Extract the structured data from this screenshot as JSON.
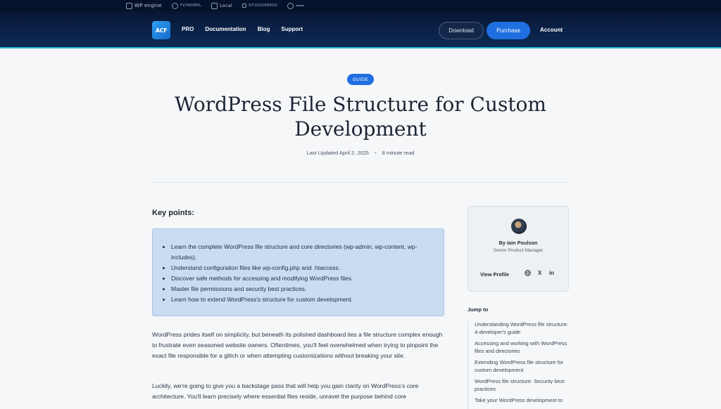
{
  "brands": [
    {
      "name": "WP engine",
      "icon": "wpengine-icon"
    },
    {
      "name": "FLYWHEEL",
      "icon": "flywheel-icon"
    },
    {
      "name": "Local",
      "icon": "local-icon"
    },
    {
      "name": "STUDIOPRESS",
      "icon": "studiopress-icon"
    },
    {
      "name": "",
      "icon": "brand-icon"
    }
  ],
  "nav": {
    "logo": "ACF",
    "links": [
      "PRO",
      "Documentation",
      "Blog",
      "Support"
    ],
    "download": "Download",
    "purchase": "Purchase",
    "account": "Account"
  },
  "article": {
    "badge": "GUIDE",
    "title": "WordPress File Structure for Custom Development",
    "updated": "Last Updated April 2, 2025",
    "read_time": "8 minute read",
    "key_points_heading": "Key points:",
    "key_points": [
      "Learn the complete WordPress file structure and core directories (wp-admin, wp-content, wp-includes).",
      "Understand configuration files like wp-config.php and .htaccess.",
      "Discover safe methods for accessing and modifying WordPress files.",
      "Master file permissions and security best practices.",
      "Learn how to extend WordPress's structure for custom development."
    ],
    "para1": "WordPress prides itself on simplicity, but beneath its polished dashboard lies a file structure complex enough to frustrate even seasoned website owners. Oftentimes, you'll feel overwhelmed when trying to pinpoint the exact file responsible for a glitch or when attempting customizations without breaking your site.",
    "para2": "Luckily, we're going to give you a backstage pass that will help you gain clarity on WordPress's core architecture. You'll learn precisely where essential files reside, unravel the purpose behind core"
  },
  "author": {
    "name": "By Iain Poulson",
    "role": "Senior Product Manager",
    "view_profile": "View Profile",
    "icons": [
      "globe-icon",
      "x-icon",
      "linkedin-icon"
    ],
    "x_glyph": "X",
    "in_glyph": "in"
  },
  "jump": {
    "title": "Jump to",
    "items": [
      "Understanding WordPress file structure: A developer's guide",
      "Accessing and working with WordPress files and directories",
      "Extending WordPress file structure for custom development",
      "WordPress file structure: Security best practices",
      "Take your WordPress development to"
    ]
  },
  "colors": {
    "accent": "#1f6fe0",
    "nav_bg": "#0a2148",
    "key_points_bg": "#c9dcf2"
  }
}
